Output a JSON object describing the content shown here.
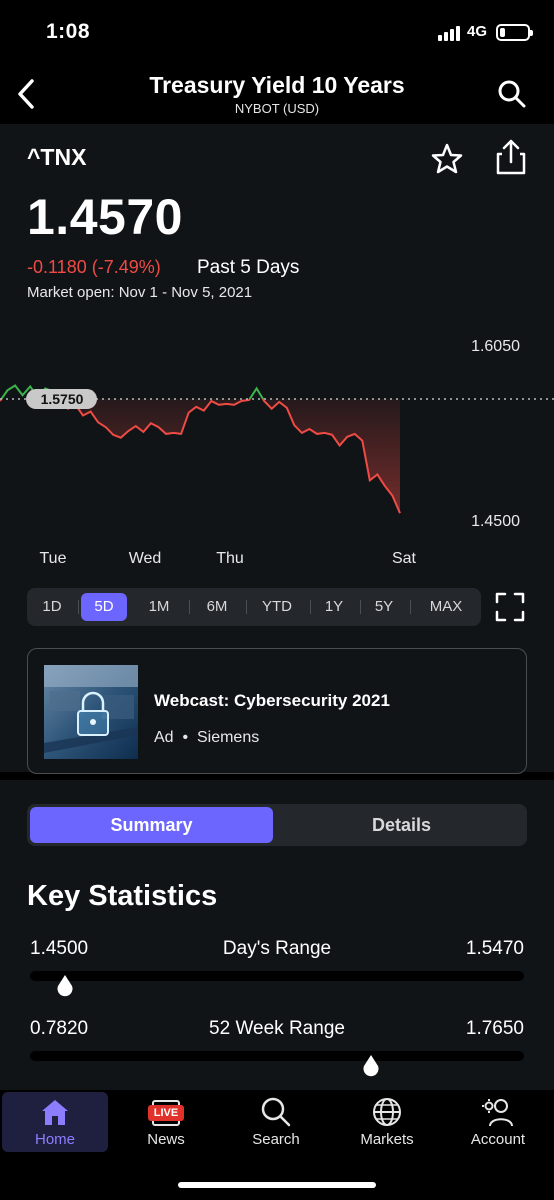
{
  "status_bar": {
    "time": "1:08",
    "network": "4G",
    "battery_level": 0.2
  },
  "nav": {
    "title": "Treasury Yield 10 Years",
    "subtitle": "NYBOT (USD)",
    "back_icon": "chevron-left-icon",
    "search_icon": "search-icon"
  },
  "quote": {
    "symbol": "^TNX",
    "price": "1.4570",
    "change": "-0.1180 (-7.49%)",
    "period": "Past 5 Days",
    "market_open": "Market open: Nov 1 - Nov 5, 2021"
  },
  "chart_data": {
    "type": "line",
    "x": [
      "Tue",
      "Wed",
      "Thu",
      "Sat"
    ],
    "y_labels": [
      "1.6050",
      "1.4500"
    ],
    "ylim": [
      1.45,
      1.605
    ],
    "previous_close": "1.5750",
    "previous_close_value": 1.575,
    "colors": {
      "up": "#3cb44b",
      "down": "#ef4b45"
    },
    "points": [
      1.573,
      1.584,
      1.589,
      1.579,
      1.588,
      1.577,
      1.586,
      1.583,
      1.571,
      1.565,
      1.569,
      1.558,
      1.562,
      1.551,
      1.546,
      1.538,
      1.535,
      1.542,
      1.547,
      1.541,
      1.55,
      1.546,
      1.539,
      1.54,
      1.539,
      1.561,
      1.567,
      1.563,
      1.573,
      1.569,
      1.57,
      1.569,
      1.573,
      1.574,
      1.586,
      1.573,
      1.565,
      1.572,
      1.566,
      1.548,
      1.54,
      1.544,
      1.539,
      1.54,
      1.538,
      1.527,
      1.536,
      1.539,
      1.532,
      1.491,
      1.497,
      1.485,
      1.475,
      1.457
    ]
  },
  "ranges": {
    "options": [
      "1D",
      "5D",
      "1M",
      "6M",
      "YTD",
      "1Y",
      "5Y",
      "MAX"
    ],
    "selected": "5D"
  },
  "ad": {
    "title": "Webcast: Cybersecurity 2021",
    "ad_label": "Ad",
    "separator": "•",
    "sponsor": "Siemens"
  },
  "tabs_segment": {
    "options": [
      "Summary",
      "Details"
    ],
    "selected": "Summary"
  },
  "key_stats": {
    "title": "Key Statistics",
    "day_range": {
      "label": "Day's Range",
      "low": "1.4500",
      "high": "1.5470",
      "position": 0.07
    },
    "week52_range": {
      "label": "52 Week Range",
      "low": "0.7820",
      "high": "1.7650",
      "position": 0.69
    }
  },
  "tabbar": {
    "home": "Home",
    "news": "News",
    "news_badge": "LIVE",
    "search": "Search",
    "markets": "Markets",
    "account": "Account",
    "selected": "Home"
  },
  "icons": [
    "chevron-left-icon",
    "search-icon",
    "star-icon",
    "share-icon",
    "fullscreen-icon",
    "home-icon",
    "news-icon",
    "search-icon",
    "globe-icon",
    "account-gear-icon"
  ]
}
